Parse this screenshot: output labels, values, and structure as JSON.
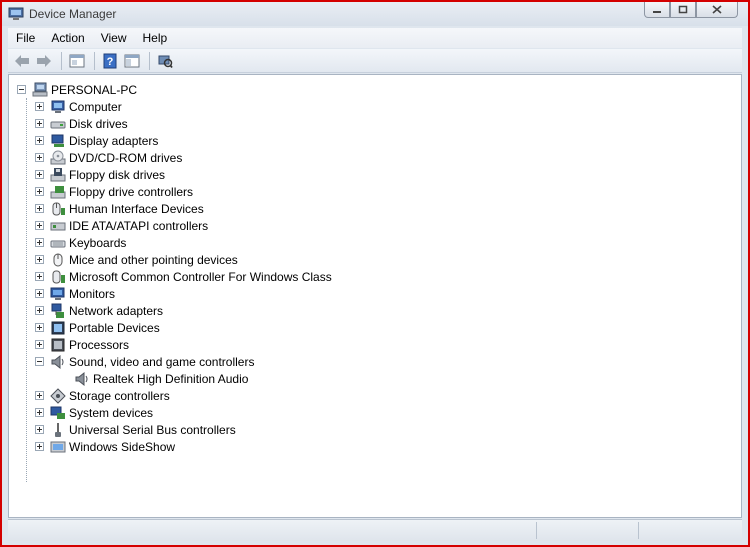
{
  "window": {
    "title": "Device Manager"
  },
  "menu": [
    "File",
    "Action",
    "View",
    "Help"
  ],
  "toolbar": [
    {
      "name": "back-arrow-icon"
    },
    {
      "name": "forward-arrow-icon"
    },
    {
      "name": "properties-icon"
    },
    {
      "name": "help-icon"
    },
    {
      "name": "show-hide-console-tree-icon"
    },
    {
      "name": "scan-hardware-icon"
    }
  ],
  "tree": {
    "root": "PERSONAL-PC",
    "items": [
      {
        "label": "Computer",
        "icon": "computer-icon",
        "expanded": false
      },
      {
        "label": "Disk drives",
        "icon": "disk-drive-icon",
        "expanded": false
      },
      {
        "label": "Display adapters",
        "icon": "display-adapter-icon",
        "expanded": false
      },
      {
        "label": "DVD/CD-ROM drives",
        "icon": "dvd-drive-icon",
        "expanded": false
      },
      {
        "label": "Floppy disk drives",
        "icon": "floppy-drive-icon",
        "expanded": false
      },
      {
        "label": "Floppy drive controllers",
        "icon": "floppy-controller-icon",
        "expanded": false
      },
      {
        "label": "Human Interface Devices",
        "icon": "hid-icon",
        "expanded": false
      },
      {
        "label": "IDE ATA/ATAPI controllers",
        "icon": "ide-controller-icon",
        "expanded": false
      },
      {
        "label": "Keyboards",
        "icon": "keyboard-icon",
        "expanded": false
      },
      {
        "label": "Mice and other pointing devices",
        "icon": "mouse-icon",
        "expanded": false
      },
      {
        "label": "Microsoft Common Controller For Windows Class",
        "icon": "controller-icon",
        "expanded": false
      },
      {
        "label": "Monitors",
        "icon": "monitor-icon",
        "expanded": false
      },
      {
        "label": "Network adapters",
        "icon": "network-adapter-icon",
        "expanded": false
      },
      {
        "label": "Portable Devices",
        "icon": "portable-device-icon",
        "expanded": false
      },
      {
        "label": "Processors",
        "icon": "processor-icon",
        "expanded": false
      },
      {
        "label": "Sound, video and game controllers",
        "icon": "speaker-icon",
        "expanded": true,
        "children": [
          {
            "label": "Realtek High Definition Audio",
            "icon": "speaker-icon"
          }
        ]
      },
      {
        "label": "Storage controllers",
        "icon": "storage-controller-icon",
        "expanded": false
      },
      {
        "label": "System devices",
        "icon": "system-device-icon",
        "expanded": false
      },
      {
        "label": "Universal Serial Bus controllers",
        "icon": "usb-icon",
        "expanded": false
      },
      {
        "label": "Windows SideShow",
        "icon": "sideshow-icon",
        "expanded": false
      }
    ]
  },
  "colors": {
    "window_border": "#d40000",
    "chrome": "#dfe6ee"
  }
}
